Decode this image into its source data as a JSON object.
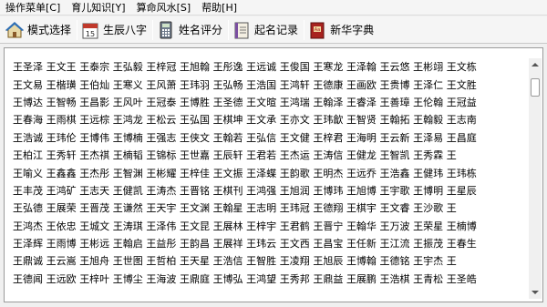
{
  "menu": {
    "items": [
      "操作菜单[C]",
      "育儿知识[Y]",
      "算命风水[S]",
      "帮助[H]"
    ]
  },
  "toolbar": {
    "buttons": [
      {
        "label": "模式选择",
        "icon": "house-icon"
      },
      {
        "label": "生辰八字",
        "icon": "calendar-icon"
      },
      {
        "label": "姓名评分",
        "icon": "calculator-icon"
      },
      {
        "label": "起名记录",
        "icon": "notebook-icon"
      },
      {
        "label": "新华字典",
        "icon": "dictionary-icon"
      }
    ]
  },
  "names": {
    "rows": [
      [
        "王圣泽",
        "王文王",
        "王泰宗",
        "王弘毅",
        "王梓冠",
        "王旭翰",
        "王彤逸",
        "王远诚",
        "王俊国",
        "王寒龙",
        "王泽翰",
        "王云悠",
        "王彬翊",
        "王文栋"
      ],
      [
        "王文易",
        "王楷璜",
        "王伯灿",
        "王寒义",
        "王风萧",
        "王玮羽",
        "王弘畅",
        "王浩国",
        "王鸿轩",
        "王德康",
        "王画欧",
        "王贵博",
        "王泽仁",
        "王文胜"
      ],
      [
        "王博达",
        "王智畅",
        "王昌影",
        "王风叶",
        "王冠泰",
        "王博胜",
        "王圣德",
        "王文暄",
        "王鸿瑞",
        "王翰泽",
        "王睿泽",
        "王善璋",
        "王伦翰",
        "王冠益"
      ],
      [
        "王春海",
        "王雨棋",
        "王远棕",
        "王鸿龙",
        "王松云",
        "王弘国",
        "王棋坤",
        "王文承",
        "王亦文",
        "王玮歙",
        "王智贤",
        "王翰拓",
        "王翰毅",
        "王志南"
      ],
      [
        "王浩诚",
        "王玮伦",
        "王博伟",
        "王博楠",
        "王强志",
        "王侠文",
        "王翰若",
        "王弘信",
        "王文健",
        "王梓君",
        "王海明",
        "王云新",
        "王泽易",
        "王昌庭"
      ],
      [
        "王柏江",
        "王秀轩",
        "王杰祺",
        "王楠韬",
        "王锦标",
        "王世嘉",
        "王辰轩",
        "王君若",
        "王杰运",
        "王涛信",
        "王健龙",
        "王智凯",
        "王秀霖",
        "王"
      ],
      [
        "王喻义",
        "王鑫鑫",
        "王杰彤",
        "王智渊",
        "王彬耀",
        "王梓佳",
        "王文振",
        "王泽蝶",
        "王韵歌",
        "王明杰",
        "王远乔",
        "王浩鑫",
        "王健玮",
        "王玮栋"
      ],
      [
        "王丰茂",
        "王鸿矿",
        "王志天",
        "王健凯",
        "王涛杰",
        "王晋铭",
        "王棋刊",
        "王鸿强",
        "王旭润",
        "王博玮",
        "王旭博",
        "王宇歌",
        "王博明",
        "王星辰"
      ],
      [
        "王弘德",
        "王展荣",
        "王晋茂",
        "王谦然",
        "王天宇",
        "王文渊",
        "王翰星",
        "王志明",
        "王玮冠",
        "王德翔",
        "王棋宇",
        "王文睿",
        "王沙歌",
        "王"
      ],
      [
        "王鸿杰",
        "王依忠",
        "王城文",
        "王涛琪",
        "王泽伟",
        "王文昆",
        "王展林",
        "王梓宇",
        "王君鹤",
        "王晋宁",
        "王翰华",
        "王万波",
        "王荣星",
        "王楠博"
      ],
      [
        "王泽辉",
        "王雨博",
        "王彬远",
        "王翰启",
        "王益彤",
        "王韵昌",
        "王展祥",
        "王玮云",
        "王文西",
        "王昌宝",
        "王任新",
        "王江流",
        "王振茂",
        "王春生"
      ],
      [
        "王鼎诚",
        "王云嵩",
        "王旭舟",
        "王世图",
        "王哲柏",
        "王天星",
        "王浩信",
        "王智胜",
        "王凌翔",
        "王旭辰",
        "王博翰",
        "王德铭",
        "王宇杰",
        "王"
      ],
      [
        "王德闻",
        "王远欧",
        "王梓叶",
        "王博尘",
        "王海波",
        "王鼎庭",
        "王博弘",
        "王鸿望",
        "王秀邦",
        "王鼎益",
        "王展鹏",
        "王浩棋",
        "王青松",
        "王圣皓"
      ]
    ]
  }
}
